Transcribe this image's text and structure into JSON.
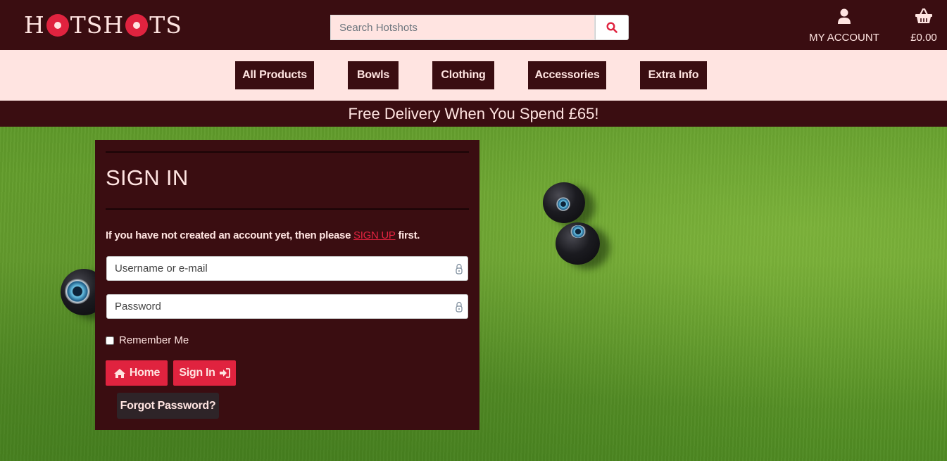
{
  "header": {
    "logo_parts": [
      "H",
      "TSH",
      "TS"
    ],
    "search": {
      "placeholder": "Search Hotshots",
      "value": ""
    },
    "account_label": "MY ACCOUNT",
    "basket_total": "£0.00"
  },
  "nav": {
    "items": [
      {
        "label": "All Products"
      },
      {
        "label": "Bowls"
      },
      {
        "label": "Clothing"
      },
      {
        "label": "Accessories"
      },
      {
        "label": "Extra Info"
      }
    ]
  },
  "banner": {
    "text": "Free Delivery When You Spend £65!"
  },
  "signin": {
    "title": "SIGN IN",
    "intro_before": "If you have not created an account yet, then please ",
    "intro_link": "SIGN UP",
    "intro_after": " first.",
    "username": {
      "placeholder": "Username or e-mail",
      "value": ""
    },
    "password": {
      "placeholder": "Password",
      "value": ""
    },
    "remember_label": "Remember Me",
    "remember_checked": false,
    "home_label": "Home",
    "signin_label": "Sign In",
    "forgot_label": "Forgot Password?"
  },
  "icons": {
    "search": "search-icon",
    "account": "user-icon",
    "basket": "basket-icon",
    "lock": "lock-icon",
    "home": "home-icon",
    "signin": "sign-in-icon"
  },
  "colors": {
    "maroon": "#3a0d11",
    "pink": "#ffe4e1",
    "red": "#e0233f",
    "dark_button": "#2e2428"
  }
}
